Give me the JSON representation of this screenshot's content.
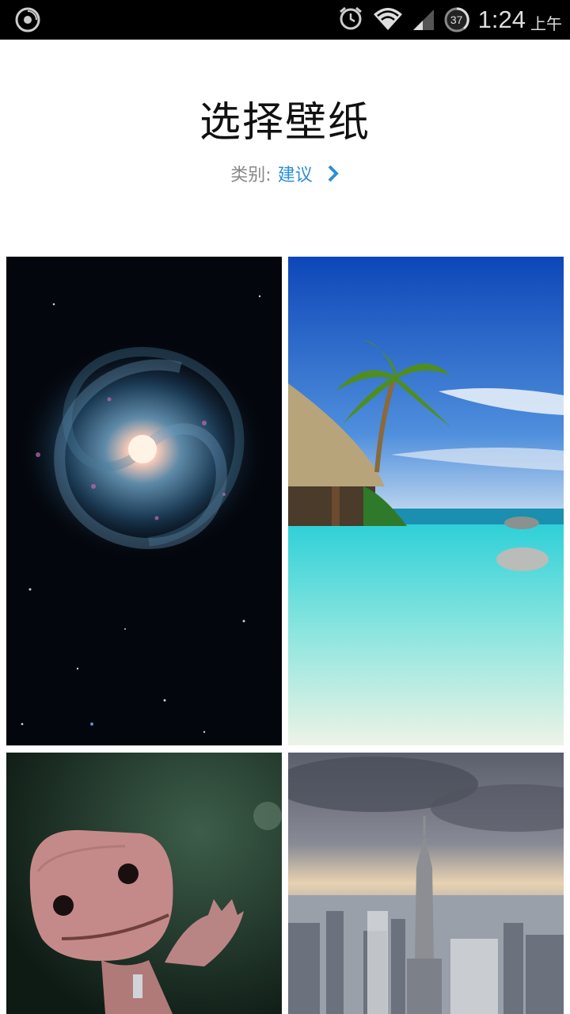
{
  "status_bar": {
    "time": "1:24",
    "ampm": "上午",
    "battery_level": "37",
    "icons": [
      "app-notification-icon",
      "alarm-icon",
      "wifi-icon",
      "signal-icon",
      "battery-icon"
    ]
  },
  "header": {
    "title": "选择壁纸",
    "category_label": "类别:",
    "category_value": "建议"
  },
  "wallpapers": [
    {
      "subject": "galaxy"
    },
    {
      "subject": "tropical-beach"
    },
    {
      "subject": "knitted-doll"
    },
    {
      "subject": "city-skyline"
    }
  ],
  "colors": {
    "accent": "#2d8fd6",
    "title": "#111111",
    "label": "#888888"
  }
}
